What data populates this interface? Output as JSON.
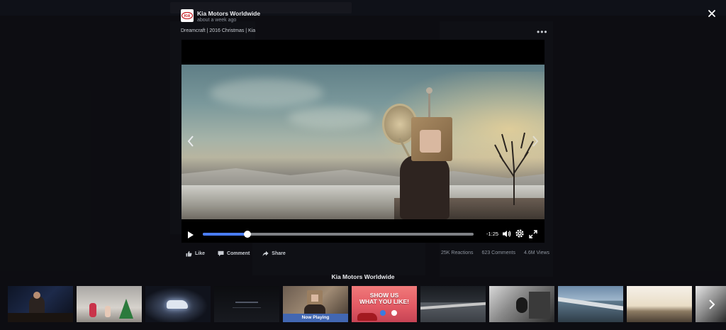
{
  "post": {
    "page_name": "Kia Motors Worldwide",
    "time": "about a week ago",
    "caption": "Dreamcraft | 2016 Christmas | Kia",
    "more_label": "•••"
  },
  "player": {
    "time_remaining": "-1:25",
    "progress_fraction": 0.165
  },
  "actions": {
    "like": "Like",
    "comment": "Comment",
    "share": "Share"
  },
  "stats": {
    "reactions": "25K Reactions",
    "comments": "623 Comments",
    "views": "4.6M Views"
  },
  "carousel": {
    "title": "Kia Motors Worldwide",
    "now_playing_label": "Now Playing",
    "promo_line1": "SHOW US",
    "promo_line2": "WHAT YOU LIKE!"
  },
  "colors": {
    "accent": "#4a7dff",
    "now_playing": "#4267b2",
    "kia_red": "#c4161c"
  },
  "icons": [
    "kia-logo-icon",
    "close-icon",
    "chevron-left-icon",
    "chevron-right-icon",
    "play-icon",
    "volume-icon",
    "gear-icon",
    "fullscreen-icon",
    "like-icon",
    "comment-icon",
    "share-icon"
  ]
}
